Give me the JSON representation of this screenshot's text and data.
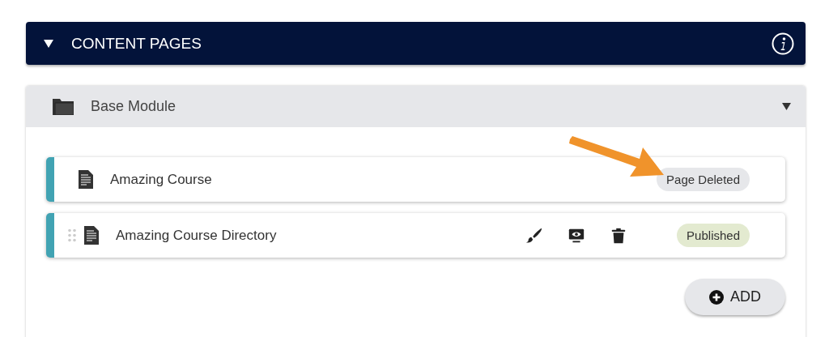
{
  "section": {
    "title": "CONTENT PAGES",
    "expanded": true
  },
  "module": {
    "title": "Base Module",
    "expanded": true
  },
  "pages": [
    {
      "title": "Amazing Course",
      "draggable": false,
      "editable": false,
      "status": {
        "kind": "deleted",
        "label": "Page Deleted"
      }
    },
    {
      "title": "Amazing Course Directory",
      "draggable": true,
      "editable": true,
      "status": {
        "kind": "published",
        "label": "Published"
      }
    }
  ],
  "annotation": {
    "kind": "arrow"
  },
  "add_button": {
    "label": "ADD"
  }
}
